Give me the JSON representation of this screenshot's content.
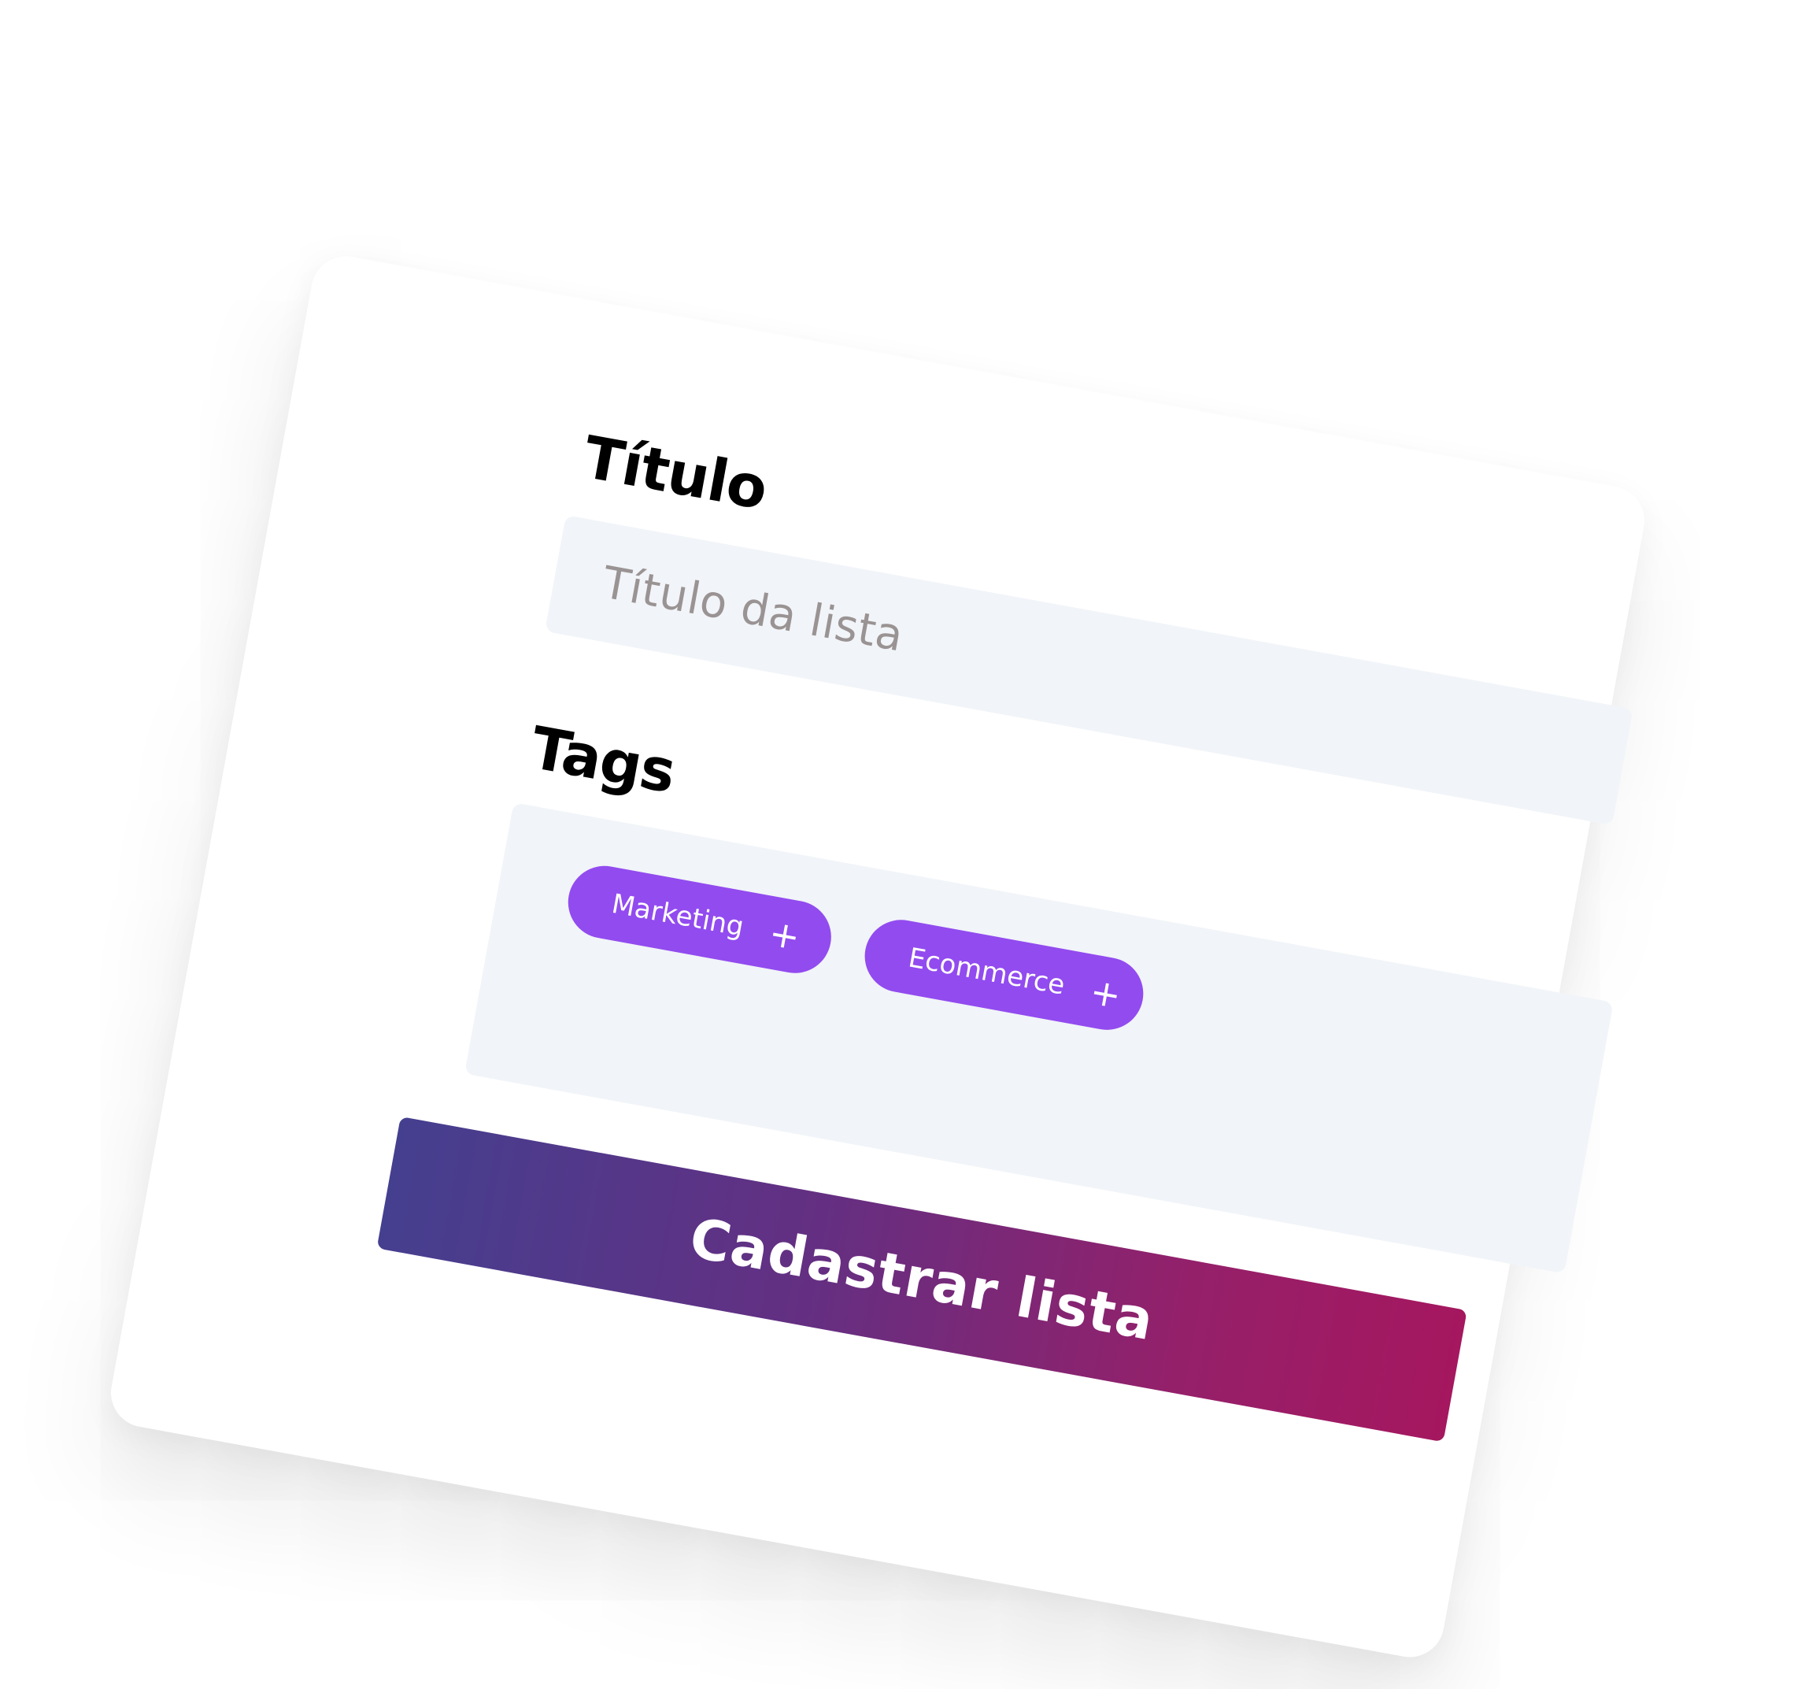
{
  "form": {
    "title_label": "Título",
    "title_placeholder": "Título da lista",
    "tags_label": "Tags",
    "tags": [
      {
        "label": "Marketing",
        "action_icon": "plus-icon",
        "action_glyph": "+"
      },
      {
        "label": "Ecommerce",
        "action_icon": "plus-icon",
        "action_glyph": "+"
      }
    ],
    "submit_label": "Cadastrar lista"
  },
  "colors": {
    "card_background": "#ffffff",
    "input_background": "#f1f4f8",
    "placeholder_text": "#9a9393",
    "chip_background": "#924bef",
    "button_gradient_start": "#453f8f",
    "button_gradient_end": "#a5175f"
  }
}
